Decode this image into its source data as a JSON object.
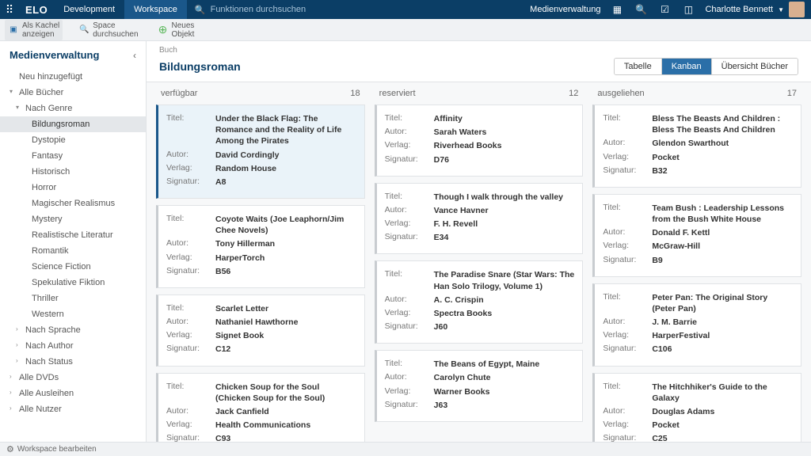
{
  "topbar": {
    "brand": "ELO",
    "nav": [
      "Development",
      "Workspace"
    ],
    "nav_active": 1,
    "search_placeholder": "Funktionen durchsuchen",
    "right_label": "Medienverwaltung",
    "user_name": "Charlotte Bennett"
  },
  "toolbar": {
    "items": [
      {
        "line1": "Als Kachel",
        "line2": "anzeigen",
        "icon": "tile"
      },
      {
        "line1": "Space",
        "line2": "durchsuchen",
        "icon": "search"
      },
      {
        "line1": "Neues",
        "line2": "Objekt",
        "icon": "plus"
      }
    ]
  },
  "sidebar": {
    "title": "Medienverwaltung",
    "tree": [
      {
        "label": "Neu hinzugefügt",
        "level": 0
      },
      {
        "label": "Alle Bücher",
        "level": 0,
        "arrow": "▾"
      },
      {
        "label": "Nach Genre",
        "level": 1,
        "arrow": "▾"
      },
      {
        "label": "Bildungsroman",
        "level": 2,
        "selected": true
      },
      {
        "label": "Dystopie",
        "level": 2
      },
      {
        "label": "Fantasy",
        "level": 2
      },
      {
        "label": "Historisch",
        "level": 2
      },
      {
        "label": "Horror",
        "level": 2
      },
      {
        "label": "Magischer Realismus",
        "level": 2
      },
      {
        "label": "Mystery",
        "level": 2
      },
      {
        "label": "Realistische Literatur",
        "level": 2
      },
      {
        "label": "Romantik",
        "level": 2
      },
      {
        "label": "Science Fiction",
        "level": 2
      },
      {
        "label": "Spekulative Fiktion",
        "level": 2
      },
      {
        "label": "Thriller",
        "level": 2
      },
      {
        "label": "Western",
        "level": 2
      },
      {
        "label": "Nach Sprache",
        "level": 1,
        "arrow": "›"
      },
      {
        "label": "Nach Author",
        "level": 1,
        "arrow": "›"
      },
      {
        "label": "Nach Status",
        "level": 1,
        "arrow": "›"
      },
      {
        "label": "Alle DVDs",
        "level": 0,
        "arrow": "›"
      },
      {
        "label": "Alle Ausleihen",
        "level": 0,
        "arrow": "›"
      },
      {
        "label": "Alle Nutzer",
        "level": 0,
        "arrow": "›"
      }
    ]
  },
  "content": {
    "breadcrumb": "Buch",
    "title": "Bildungsroman",
    "view_tabs": [
      "Tabelle",
      "Kanban",
      "Übersicht Bücher"
    ],
    "view_active": 1,
    "field_labels": {
      "title": "Titel:",
      "author": "Autor:",
      "publisher": "Verlag:",
      "signature": "Signatur:"
    },
    "columns": [
      {
        "name": "verfügbar",
        "count": 18,
        "cards": [
          {
            "highlight": true,
            "title": "Under the Black Flag: The Romance and the Reality of Life Among the Pirates",
            "author": "David Cordingly",
            "publisher": "Random House",
            "signature": "A8"
          },
          {
            "title": "Coyote Waits (Joe Leaphorn/Jim Chee Novels)",
            "author": "Tony Hillerman",
            "publisher": "HarperTorch",
            "signature": "B56"
          },
          {
            "title": "Scarlet Letter",
            "author": "Nathaniel Hawthorne",
            "publisher": "Signet Book",
            "signature": "C12"
          },
          {
            "title": "Chicken Soup for the Soul (Chicken Soup for the Soul)",
            "author": "Jack Canfield",
            "publisher": "Health Communications",
            "signature": "C93"
          }
        ]
      },
      {
        "name": "reserviert",
        "count": 12,
        "cards": [
          {
            "title": "Affinity",
            "author": "Sarah Waters",
            "publisher": "Riverhead Books",
            "signature": "D76"
          },
          {
            "title": "Though I walk through the valley",
            "author": "Vance Havner",
            "publisher": "F. H. Revell",
            "signature": "E34"
          },
          {
            "title": "The Paradise Snare (Star Wars: The Han Solo Trilogy, Volume 1)",
            "author": "A. C. Crispin",
            "publisher": "Spectra Books",
            "signature": "J60"
          },
          {
            "title": "The Beans of Egypt, Maine",
            "author": "Carolyn Chute",
            "publisher": "Warner Books",
            "signature": "J63"
          }
        ]
      },
      {
        "name": "ausgeliehen",
        "count": 17,
        "cards": [
          {
            "title": "Bless The Beasts And Children : Bless The Beasts And Children",
            "author": "Glendon Swarthout",
            "publisher": "Pocket",
            "signature": "B32"
          },
          {
            "title": "Team Bush : Leadership Lessons from the Bush White House",
            "author": "Donald F. Kettl",
            "publisher": "McGraw-Hill",
            "signature": "B9"
          },
          {
            "title": "Peter Pan: The Original Story (Peter Pan)",
            "author": "J. M. Barrie",
            "publisher": "HarperFestival",
            "signature": "C106"
          },
          {
            "title": "The Hitchhiker's Guide to the Galaxy",
            "author": "Douglas Adams",
            "publisher": "Pocket",
            "signature": "C25"
          }
        ]
      }
    ]
  },
  "statusbar": {
    "text": "Workspace bearbeiten"
  }
}
